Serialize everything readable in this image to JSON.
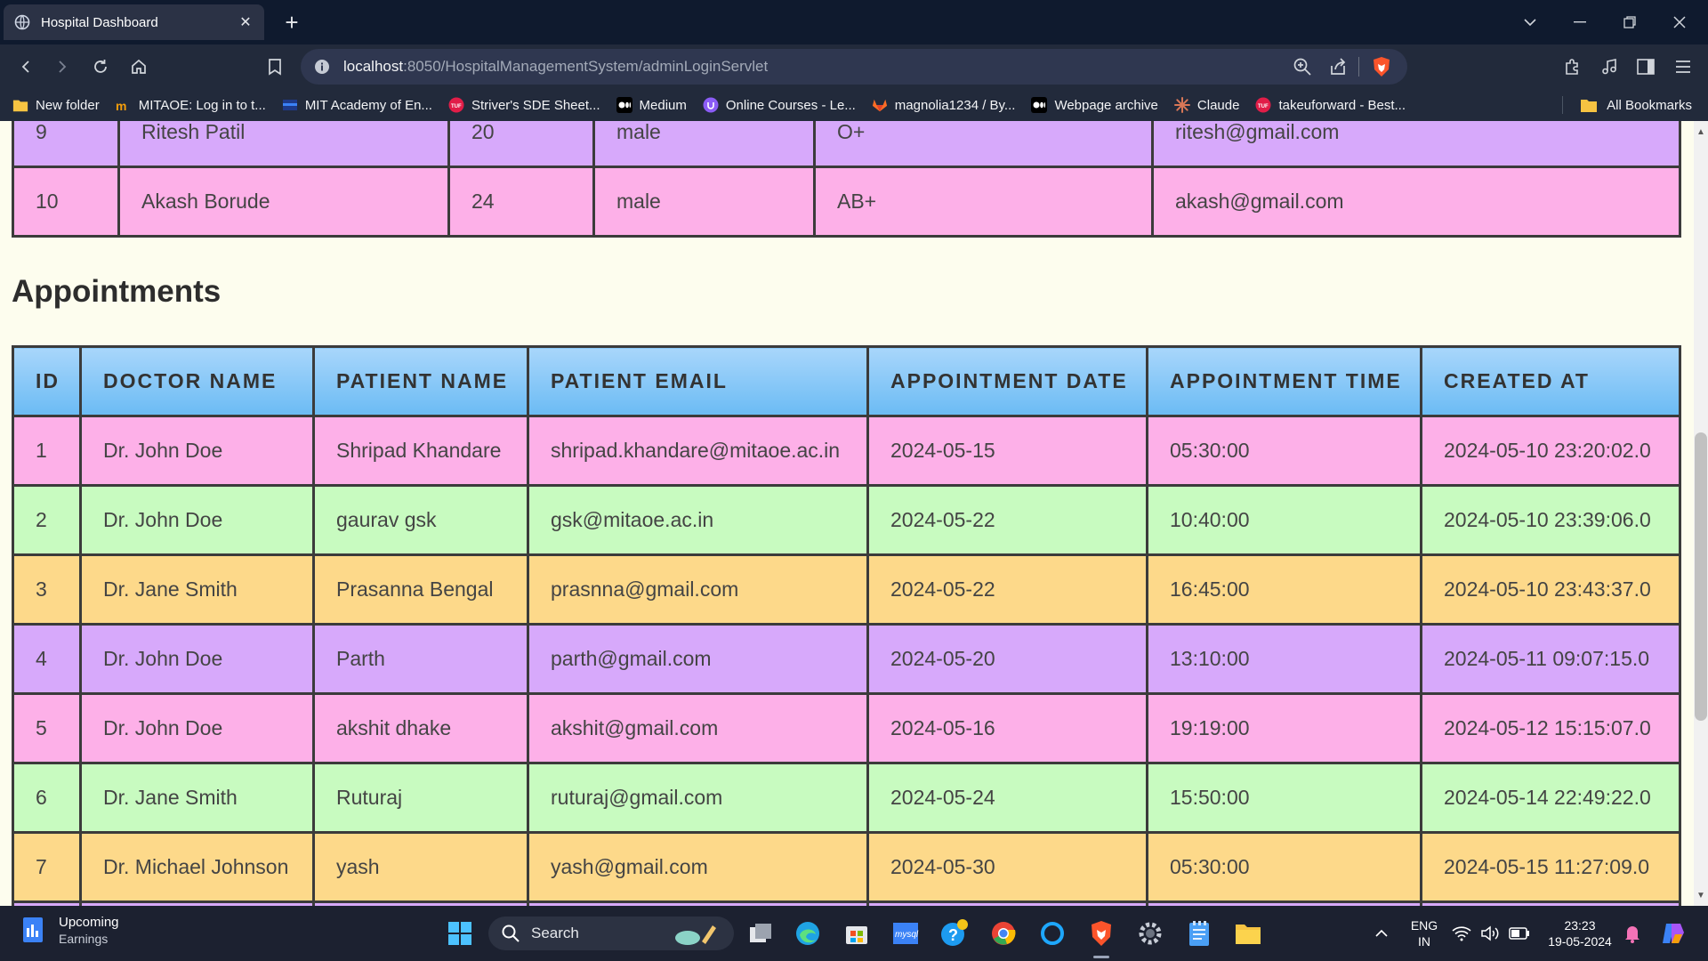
{
  "browser": {
    "tab_title": "Hospital Dashboard",
    "tab_close": "✕",
    "new_tab": "+",
    "url_host": "localhost",
    "url_rest": ":8050/HospitalManagementSystem/adminLoginServlet",
    "bookmarks": [
      {
        "label": "New folder",
        "icon": "folder-icon"
      },
      {
        "label": "MITAOE: Log in to t...",
        "icon": "mitaoe-icon"
      },
      {
        "label": "MIT Academy of En...",
        "icon": "mit-icon"
      },
      {
        "label": "Striver's SDE Sheet...",
        "icon": "tuf-icon"
      },
      {
        "label": "Medium",
        "icon": "medium-icon"
      },
      {
        "label": "Online Courses - Le...",
        "icon": "udemy-icon"
      },
      {
        "label": "magnolia1234 / By...",
        "icon": "gitlab-icon"
      },
      {
        "label": "Webpage archive",
        "icon": "archive-icon"
      },
      {
        "label": "Claude",
        "icon": "claude-icon"
      },
      {
        "label": "takeuforward - Best...",
        "icon": "tuf-icon"
      }
    ],
    "all_bookmarks": "All Bookmarks"
  },
  "patients": {
    "rows": [
      [
        "9",
        "Ritesh Patil",
        "20",
        "male",
        "O+",
        "ritesh@gmail.com"
      ],
      [
        "10",
        "Akash Borude",
        "24",
        "male",
        "AB+",
        "akash@gmail.com"
      ]
    ],
    "row_colors": [
      "#d7a9fb",
      "#fdb0e8"
    ]
  },
  "appointments": {
    "title": "Appointments",
    "headers": [
      "ID",
      "DOCTOR NAME",
      "PATIENT NAME",
      "PATIENT EMAIL",
      "APPOINTMENT DATE",
      "APPOINTMENT TIME",
      "CREATED AT"
    ],
    "rows": [
      [
        "1",
        "Dr. John Doe",
        "Shripad Khandare",
        "shripad.khandare@mitaoe.ac.in",
        "2024-05-15",
        "05:30:00",
        "2024-05-10 23:20:02.0"
      ],
      [
        "2",
        "Dr. John Doe",
        "gaurav gsk",
        "gsk@mitaoe.ac.in",
        "2024-05-22",
        "10:40:00",
        "2024-05-10 23:39:06.0"
      ],
      [
        "3",
        "Dr. Jane Smith",
        "Prasanna Bengal",
        "prasnna@gmail.com",
        "2024-05-22",
        "16:45:00",
        "2024-05-10 23:43:37.0"
      ],
      [
        "4",
        "Dr. John Doe",
        "Parth",
        "parth@gmail.com",
        "2024-05-20",
        "13:10:00",
        "2024-05-11 09:07:15.0"
      ],
      [
        "5",
        "Dr. John Doe",
        "akshit dhake",
        "akshit@gmail.com",
        "2024-05-16",
        "19:19:00",
        "2024-05-12 15:15:07.0"
      ],
      [
        "6",
        "Dr. Jane Smith",
        "Ruturaj",
        "ruturaj@gmail.com",
        "2024-05-24",
        "15:50:00",
        "2024-05-14 22:49:22.0"
      ],
      [
        "7",
        "Dr. Michael Johnson",
        "yash",
        "yash@gmail.com",
        "2024-05-30",
        "05:30:00",
        "2024-05-15 11:27:09.0"
      ],
      [
        "",
        "",
        "",
        "",
        "",
        "",
        ""
      ]
    ],
    "row_colors": [
      "#fdb0e8",
      "#c8fbc0",
      "#fdd98a",
      "#d7a9fb",
      "#fdb0e8",
      "#c8fbc0",
      "#fdd98a",
      "#d7a9fb"
    ]
  },
  "taskbar": {
    "weather_title": "Upcoming",
    "weather_sub": "Earnings",
    "search_label": "Search",
    "lang_top": "ENG",
    "lang_bottom": "IN",
    "time": "23:23",
    "date": "19-05-2024"
  },
  "colors": {
    "page_bg": "#fdfdee",
    "header_gradient_top": "#a8d6fb",
    "header_gradient_bottom": "#6bbbf4",
    "table_border": "#3b3b3b"
  }
}
